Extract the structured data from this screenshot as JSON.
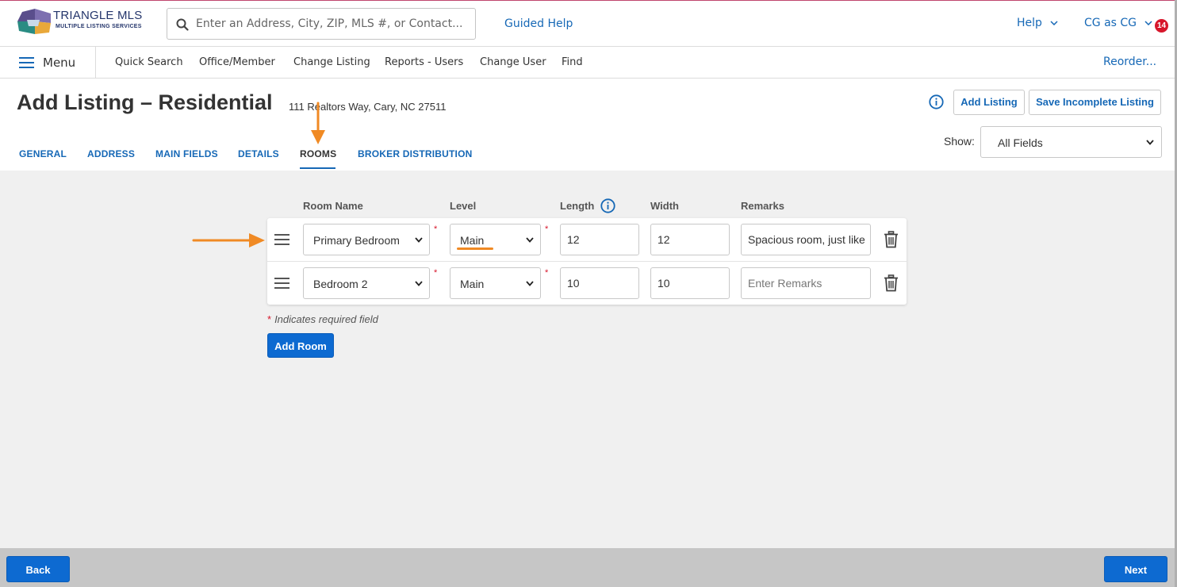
{
  "brand": {
    "name": "TRIANGLE MLS",
    "tagline": "MULTIPLE LISTING SERVICES"
  },
  "header": {
    "search_placeholder": "Enter an Address, City, ZIP, MLS #, or Contact...",
    "guided_help": "Guided Help",
    "help": "Help",
    "user": "CG as CG",
    "notifications": "14"
  },
  "nav": {
    "menu": "Menu",
    "links": [
      "Quick Search",
      "Office/Member",
      "Change Listing",
      "Reports - Users",
      "Change User",
      "Find"
    ],
    "reorder": "Reorder..."
  },
  "page": {
    "title": "Add Listing – Residential",
    "address": "111 Realtors Way, Cary, NC 27511",
    "add_listing": "Add Listing",
    "save_incomplete": "Save Incomplete Listing",
    "show_label": "Show:",
    "show_value": "All Fields"
  },
  "tabs": [
    {
      "label": "GENERAL",
      "active": false
    },
    {
      "label": "ADDRESS",
      "active": false
    },
    {
      "label": "MAIN FIELDS",
      "active": false
    },
    {
      "label": "DETAILS",
      "active": false
    },
    {
      "label": "ROOMS",
      "active": true
    },
    {
      "label": "BROKER DISTRIBUTION",
      "active": false
    }
  ],
  "rooms": {
    "columns": [
      "Room Name",
      "Level",
      "Length",
      "Width",
      "Remarks"
    ],
    "rows": [
      {
        "room_name": "Primary Bedroom",
        "level": "Main",
        "length": "12",
        "width": "12",
        "remarks": "Spacious room, just like"
      },
      {
        "room_name": "Bedroom 2",
        "level": "Main",
        "length": "10",
        "width": "10",
        "remarks": ""
      }
    ],
    "remarks_placeholder": "Enter Remarks",
    "required_mark": "*",
    "required_note": "Indicates required field",
    "add_room": "Add Room"
  },
  "footer": {
    "back": "Back",
    "next": "Next"
  },
  "colors": {
    "accent_blue": "#1668b6",
    "primary_button": "#0d6ad1",
    "annotation_orange": "#f08a24",
    "required_red": "#d7162b"
  }
}
